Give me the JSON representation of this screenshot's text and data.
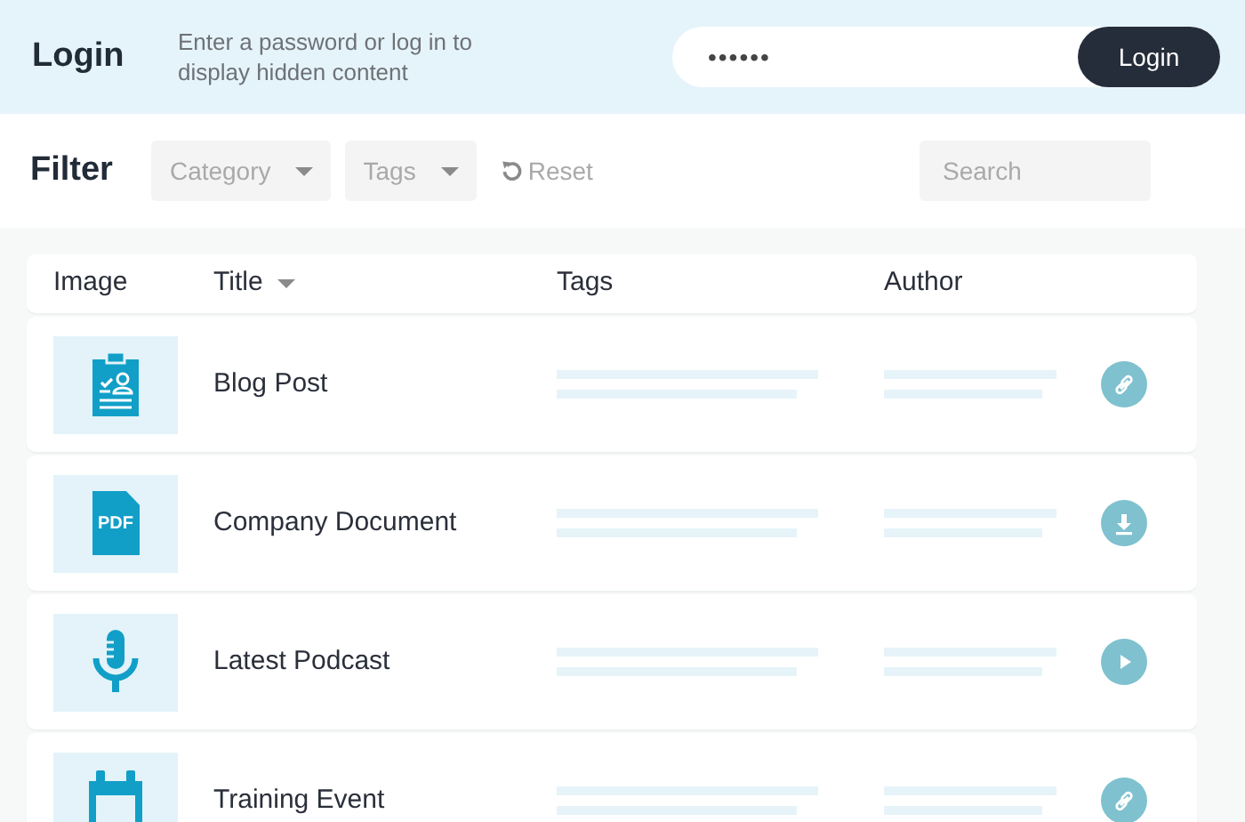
{
  "login": {
    "title": "Login",
    "hint": "Enter a password or log in to display hidden content",
    "password_value": "••••••",
    "button": "Login"
  },
  "filter": {
    "title": "Filter",
    "dropdowns": [
      "Category",
      "Tags"
    ],
    "reset": "Reset",
    "search_placeholder": "Search"
  },
  "table": {
    "columns": [
      {
        "label": "Image",
        "sortable": false
      },
      {
        "label": "Title",
        "sortable": true
      },
      {
        "label": "Tags",
        "sortable": false
      },
      {
        "label": "Author",
        "sortable": false
      }
    ],
    "rows": [
      {
        "title": "Blog Post",
        "image": {
          "kind": "clipboard"
        },
        "action": {
          "kind": "link"
        }
      },
      {
        "title": "Company Document",
        "image": {
          "kind": "pdf",
          "text": "PDF"
        },
        "action": {
          "kind": "download"
        }
      },
      {
        "title": "Latest Podcast",
        "image": {
          "kind": "microphone"
        },
        "action": {
          "kind": "play"
        }
      },
      {
        "title": "Training Event",
        "image": {
          "kind": "calendar"
        },
        "action": {
          "kind": "link"
        }
      }
    ]
  }
}
